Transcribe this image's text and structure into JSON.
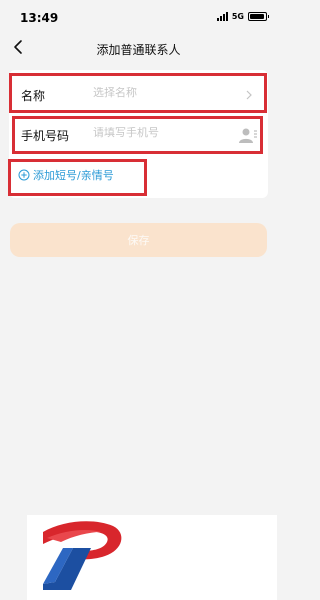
{
  "status": {
    "time": "13:49",
    "network": "5G"
  },
  "nav": {
    "title": "添加普通联系人"
  },
  "form": {
    "name": {
      "label": "名称",
      "placeholder": "选择名称"
    },
    "phone": {
      "label": "手机号码",
      "placeholder": "请填写手机号"
    },
    "add_link": "添加短号/亲情号"
  },
  "save_label": "保存",
  "colors": {
    "accent": "#2b9ad6",
    "highlight": "#d82e35",
    "save_bg": "#fae3cd"
  }
}
